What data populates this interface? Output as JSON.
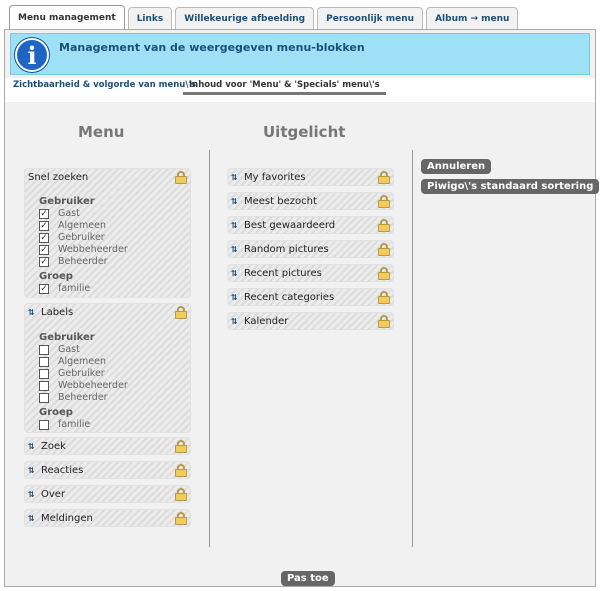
{
  "tabs": [
    "Menu management",
    "Links",
    "Willekeurige afbeelding",
    "Persoonlijk menu",
    "Album → menu"
  ],
  "info_message": "Management van de weergegeven menu-blokken",
  "subtabs": [
    "Zichtbaarheid & volgorde van menu\\'s",
    "Inhoud voor 'Menu' & 'Specials' menu\\'s"
  ],
  "menu": {
    "title": "Menu",
    "quick_search": {
      "label": "Snel zoeken",
      "users_heading": "Gebruiker",
      "users": [
        {
          "label": "Gast",
          "checked": true
        },
        {
          "label": "Algemeen",
          "checked": true
        },
        {
          "label": "Gebruiker",
          "checked": true
        },
        {
          "label": "Webbeheerder",
          "checked": true
        },
        {
          "label": "Beheerder",
          "checked": true
        }
      ],
      "groups_heading": "Groep",
      "groups": [
        {
          "label": "familie",
          "checked": true
        }
      ]
    },
    "labels": {
      "label": "Labels",
      "users_heading": "Gebruiker",
      "users": [
        {
          "label": "Gast",
          "checked": false
        },
        {
          "label": "Algemeen",
          "checked": false
        },
        {
          "label": "Gebruiker",
          "checked": false
        },
        {
          "label": "Webbeheerder",
          "checked": false
        },
        {
          "label": "Beheerder",
          "checked": false
        }
      ],
      "groups_heading": "Groep",
      "groups": [
        {
          "label": "familie",
          "checked": false
        }
      ]
    },
    "other_blocks": [
      "Zoek",
      "Reacties",
      "Over",
      "Meldingen"
    ]
  },
  "featured": {
    "title": "Uitgelicht",
    "blocks": [
      "My favorites",
      "Meest bezocht",
      "Best gewaardeerd",
      "Random pictures",
      "Recent pictures",
      "Recent categories",
      "Kalender"
    ]
  },
  "buttons": {
    "cancel": "Annuleren",
    "default_sort": "Piwigo\\'s standaard sortering",
    "apply": "Pas toe"
  },
  "colors": {
    "info_bg": "#9ee1f7",
    "link": "#1a4f79",
    "button_bg": "#666666"
  }
}
